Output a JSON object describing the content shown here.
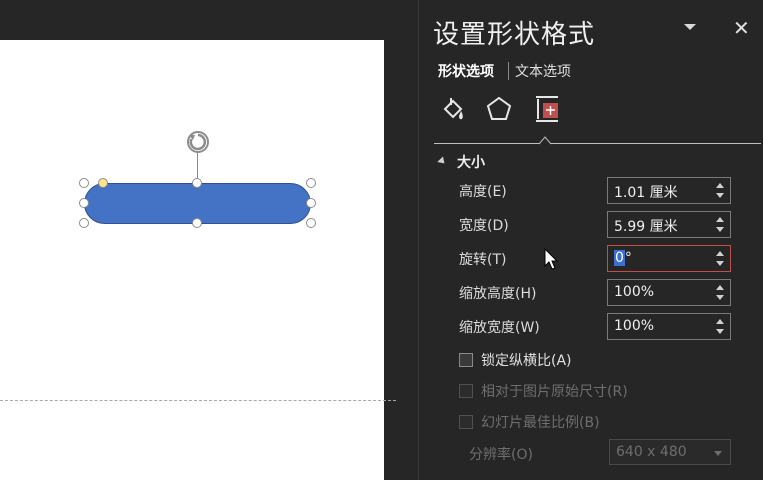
{
  "pane": {
    "title": "设置形状格式",
    "tabs": {
      "shape_options": "形状选项",
      "text_options": "文本选项"
    },
    "icons": [
      "fill-line-icon",
      "effects-pentagon-icon",
      "size-properties-icon"
    ],
    "section_title": "大小",
    "fields": [
      {
        "label": "高度(E)",
        "value": "1.01 厘米"
      },
      {
        "label": "宽度(D)",
        "value": "5.99 厘米"
      },
      {
        "label": "旋转(T)",
        "value_selected": "0",
        "value_rest": "°"
      },
      {
        "label": "缩放高度(H)",
        "value": "100%"
      },
      {
        "label": "缩放宽度(W)",
        "value": "100%"
      }
    ],
    "checkboxes": [
      {
        "label": "锁定纵横比(A)",
        "enabled": true,
        "checked": false
      },
      {
        "label": "相对于图片原始尺寸(R)",
        "enabled": false,
        "checked": false
      },
      {
        "label": "幻灯片最佳比例(B)",
        "enabled": false,
        "checked": false
      }
    ],
    "resolution": {
      "label": "分辨率(O)",
      "value": "640 x 480"
    }
  },
  "colors": {
    "shape_fill": "#4472c4",
    "pane_bg": "#262626",
    "focus_border": "#c0504d",
    "adjust_handle": "#fce58c"
  }
}
